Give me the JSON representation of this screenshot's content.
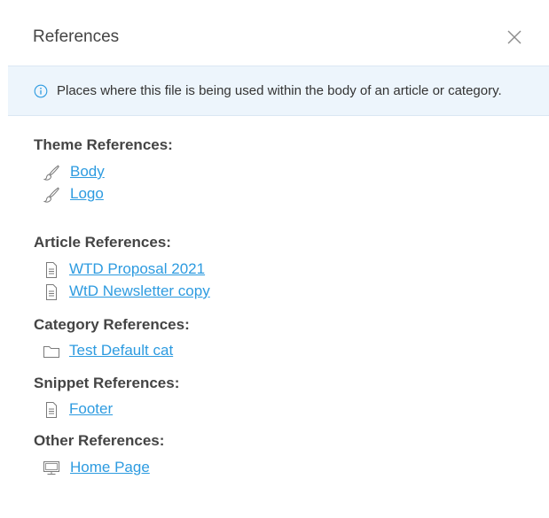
{
  "dialog": {
    "title": "References",
    "info_text": "Places where this file is being used within the body of an article or category."
  },
  "sections": {
    "theme": {
      "title": "Theme References:",
      "items": [
        {
          "label": "Body",
          "icon": "brush-icon"
        },
        {
          "label": "Logo",
          "icon": "brush-icon"
        }
      ]
    },
    "article": {
      "title": "Article References:",
      "items": [
        {
          "label": "WTD Proposal 2021",
          "icon": "document-icon"
        },
        {
          "label": "WtD Newsletter copy",
          "icon": "document-icon"
        }
      ]
    },
    "category": {
      "title": "Category References:",
      "items": [
        {
          "label": "Test Default cat",
          "icon": "folder-icon"
        }
      ]
    },
    "snippet": {
      "title": "Snippet References:",
      "items": [
        {
          "label": "Footer",
          "icon": "document-icon"
        }
      ]
    },
    "other": {
      "title": "Other References:",
      "items": [
        {
          "label": "Home Page",
          "icon": "monitor-icon"
        }
      ]
    }
  },
  "colors": {
    "link": "#2d9be0",
    "info_background": "#edf5fc",
    "heading": "#444444"
  }
}
